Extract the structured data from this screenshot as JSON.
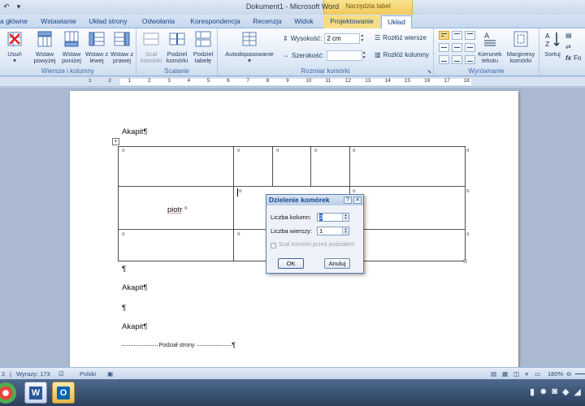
{
  "window": {
    "title": "Dokument1 - Microsoft Word",
    "context_group": "Narzędzia tabel"
  },
  "tabs": [
    {
      "label": "a główne"
    },
    {
      "label": "Wstawianie"
    },
    {
      "label": "Układ strony"
    },
    {
      "label": "Odwołania"
    },
    {
      "label": "Korespondencja"
    },
    {
      "label": "Recenzja"
    },
    {
      "label": "Widok"
    },
    {
      "label": "Projektowanie"
    },
    {
      "label": "Układ",
      "active": true
    }
  ],
  "ribbon": {
    "groups": {
      "rows_cols": "Wiersze i kolumny",
      "merge": "Scalanie",
      "cell_size": "Rozmiar komórki",
      "alignment": "Wyrównanie"
    },
    "buttons": {
      "delete": "Usuń",
      "insert_above": "Wstaw powyżej",
      "insert_below": "Wstaw poniżej",
      "insert_left": "Wstaw z lewej",
      "insert_right": "Wstaw z prawej",
      "merge_cells": "Scal komórki",
      "split_cells": "Podziel komórki",
      "split_table": "Podziel tabelę",
      "autofit": "Autodopasowanie",
      "text_direction": "Kierunek tekstu",
      "cell_margins": "Marginesy komórki",
      "sort": "Sortuj",
      "f_label": "Fo"
    },
    "height_label": "Wysokość:",
    "height_value": "2 cm",
    "width_label": "Szerokość:",
    "width_value": "",
    "distribute_rows": "Rozłóż wiersze",
    "distribute_cols": "Rozłóż kolumny"
  },
  "ruler": {
    "numbers": [
      "1",
      "2",
      "1",
      "2",
      "3",
      "4",
      "5",
      "6",
      "7",
      "8",
      "9",
      "10",
      "11",
      "12",
      "13",
      "14",
      "15",
      "16",
      "17",
      "18"
    ]
  },
  "document": {
    "para1": "Akapit¶",
    "table_text": "piotr",
    "para_mark": "¶",
    "para2": "Akapit¶",
    "para3": "¶",
    "para4": "Akapit¶",
    "page_break": "Podział strony"
  },
  "dialog": {
    "title": "Dzielenie komórek",
    "help": "?",
    "close": "✕",
    "cols_label": "Liczba kolumn:",
    "cols_value": "2",
    "rows_label": "Liczba wierszy:",
    "rows_value": "1",
    "merge_before_label": "Scal komórki przed podziałem",
    "ok": "OK",
    "cancel": "Anuluj"
  },
  "status": {
    "page": "2",
    "words": "Wyrazy: 173",
    "language": "Polski",
    "zoom": "180%"
  }
}
